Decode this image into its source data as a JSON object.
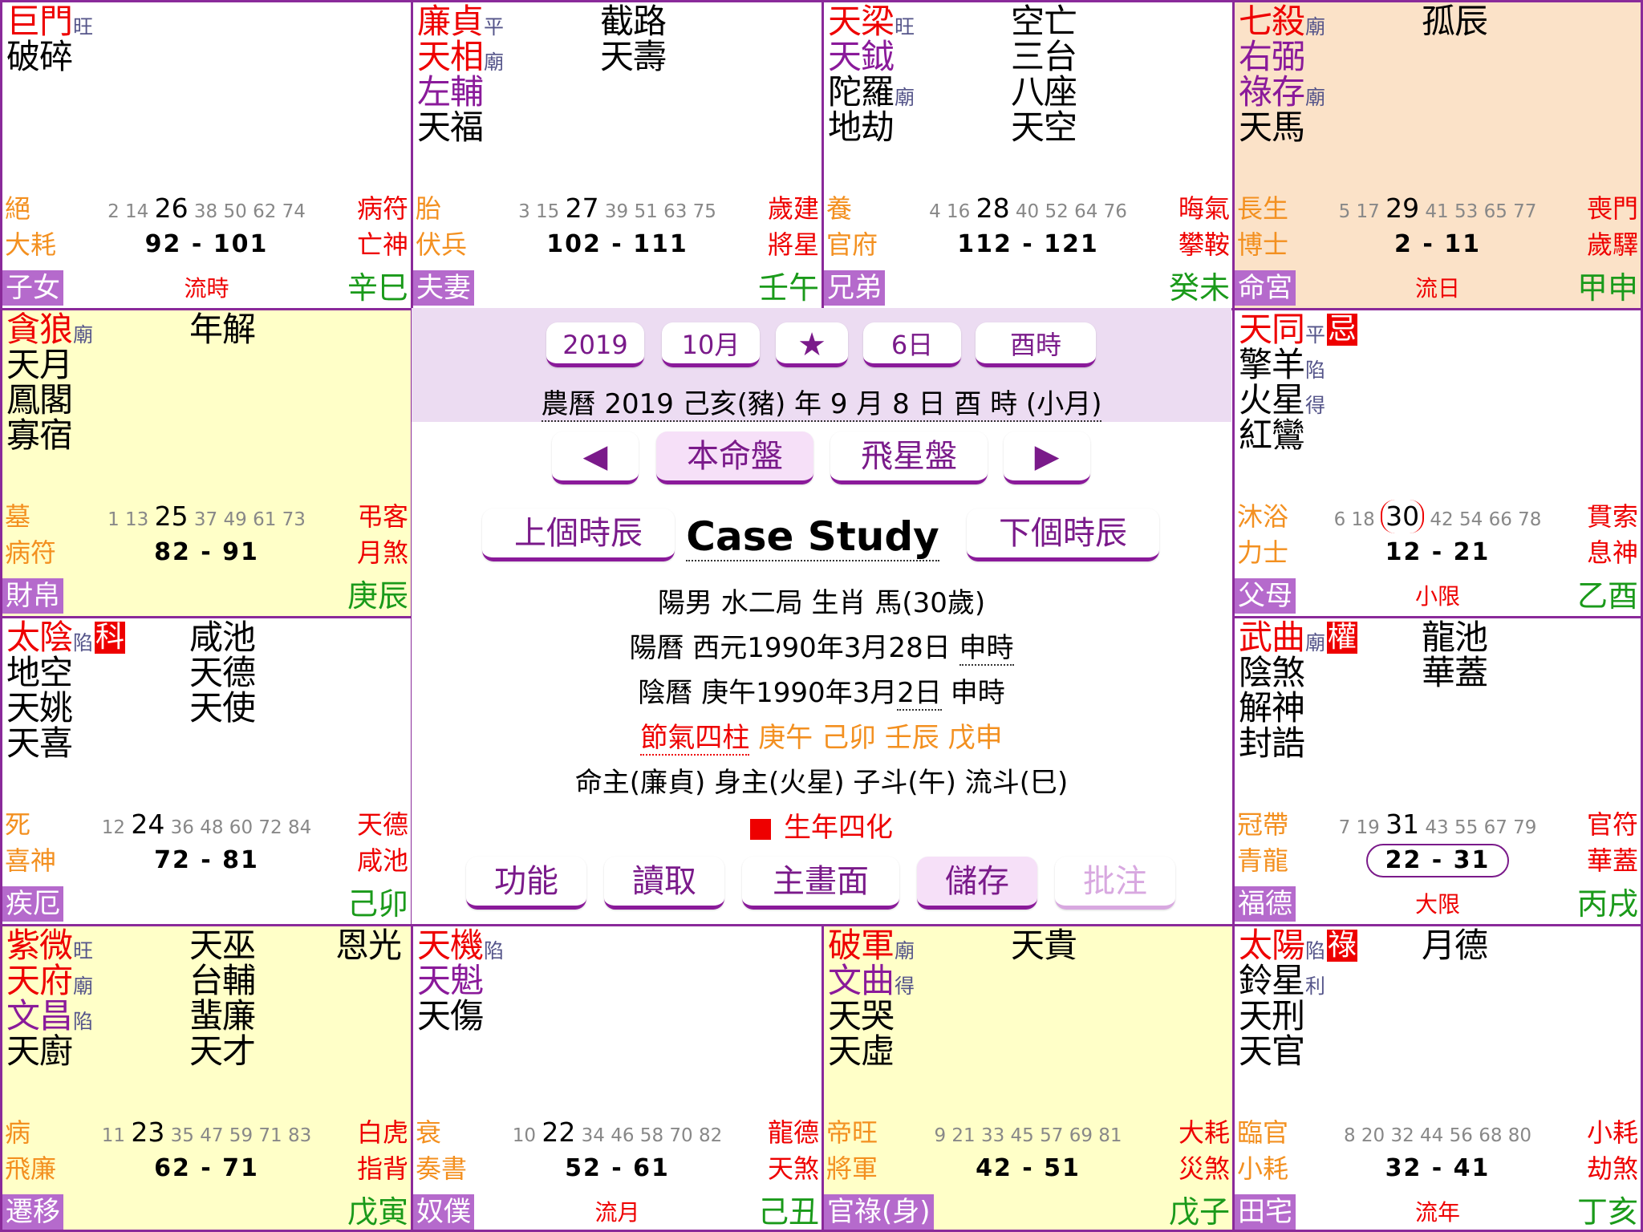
{
  "palaces": [
    {
      "id": "si",
      "stars": [
        {
          "n": "巨門",
          "c": "red",
          "b": "旺"
        },
        {
          "n": "破碎",
          "c": "black"
        }
      ],
      "minor1": [],
      "minor2": [],
      "state": "絕",
      "god": "大耗",
      "ages": {
        "pre": "2 14",
        "big": "26",
        "post": "38 50 62 74"
      },
      "range": "92 - 101",
      "r1": "病符",
      "r2": "亡神",
      "name": "子女",
      "liu": "流時",
      "stem": "辛巳"
    },
    {
      "id": "wu",
      "stars": [
        {
          "n": "廉貞",
          "c": "red",
          "b": "平"
        },
        {
          "n": "天相",
          "c": "red",
          "b": "廟"
        },
        {
          "n": "左輔",
          "c": "purple"
        },
        {
          "n": "天福",
          "c": "black"
        }
      ],
      "minor1": [
        "截路",
        "天壽"
      ],
      "minor2": [],
      "state": "胎",
      "god": "伏兵",
      "ages": {
        "pre": "3 15",
        "big": "27",
        "post": "39 51 63 75"
      },
      "range": "102 - 111",
      "r1": "歲建",
      "r2": "將星",
      "name": "夫妻",
      "liu": "",
      "stem": "壬午"
    },
    {
      "id": "wei",
      "stars": [
        {
          "n": "天梁",
          "c": "red",
          "b": "旺"
        },
        {
          "n": "天鉞",
          "c": "purple"
        },
        {
          "n": "陀羅",
          "c": "black",
          "b": "廟"
        },
        {
          "n": "地劫",
          "c": "black"
        }
      ],
      "minor1": [
        "空亡",
        "三台",
        "八座",
        "天空"
      ],
      "minor2": [],
      "state": "養",
      "god": "官府",
      "ages": {
        "pre": "4 16",
        "big": "28",
        "post": "40 52 64 76"
      },
      "range": "112 - 121",
      "r1": "晦氣",
      "r2": "攀鞍",
      "name": "兄弟",
      "liu": "",
      "stem": "癸未"
    },
    {
      "id": "shen",
      "stars": [
        {
          "n": "七殺",
          "c": "red",
          "b": "廟"
        },
        {
          "n": "右弼",
          "c": "purple"
        },
        {
          "n": "祿存",
          "c": "purple",
          "b": "廟"
        },
        {
          "n": "天馬",
          "c": "black"
        }
      ],
      "minor1": [
        "孤辰"
      ],
      "minor2": [],
      "state": "長生",
      "god": "博士",
      "ages": {
        "pre": "5 17",
        "big": "29",
        "post": "41 53 65 77"
      },
      "range": "2 - 11",
      "r1": "喪門",
      "r2": "歲驛",
      "name": "命宮",
      "liu": "流日",
      "stem": "甲申"
    },
    {
      "id": "chen",
      "stars": [
        {
          "n": "貪狼",
          "c": "red",
          "b": "廟"
        },
        {
          "n": "天月",
          "c": "black"
        },
        {
          "n": "鳳閣",
          "c": "black"
        },
        {
          "n": "寡宿",
          "c": "black"
        }
      ],
      "minor1": [
        "年解"
      ],
      "minor2": [],
      "state": "墓",
      "god": "病符",
      "ages": {
        "pre": "1 13",
        "big": "25",
        "post": "37 49 61 73"
      },
      "range": "82 - 91",
      "r1": "弔客",
      "r2": "月煞",
      "name": "財帛",
      "liu": "",
      "stem": "庚辰"
    },
    {
      "id": "you",
      "stars": [
        {
          "n": "天同",
          "c": "red",
          "b": "平",
          "h": "忌"
        },
        {
          "n": "擎羊",
          "c": "black",
          "b": "陷"
        },
        {
          "n": "火星",
          "c": "black",
          "b": "得"
        },
        {
          "n": "紅鸞",
          "c": "black"
        }
      ],
      "minor1": [],
      "minor2": [],
      "state": "沐浴",
      "god": "力士",
      "ages": {
        "pre": "6 18",
        "big": "30",
        "post": "42 54 66 78",
        "circle": true
      },
      "range": "12 - 21",
      "r1": "貫索",
      "r2": "息神",
      "name": "父母",
      "liu": "小限",
      "stem": "乙酉"
    },
    {
      "id": "mao",
      "stars": [
        {
          "n": "太陰",
          "c": "red",
          "b": "陷",
          "h": "科"
        },
        {
          "n": "地空",
          "c": "black"
        },
        {
          "n": "天姚",
          "c": "black"
        },
        {
          "n": "天喜",
          "c": "black"
        }
      ],
      "minor1": [
        "咸池",
        "天德",
        "天使"
      ],
      "minor2": [],
      "state": "死",
      "god": "喜神",
      "ages": {
        "pre": "12",
        "big": "24",
        "post": "36 48 60 72 84"
      },
      "range": "72 - 81",
      "r1": "天德",
      "r2": "咸池",
      "name": "疾厄",
      "liu": "",
      "stem": "己卯"
    },
    {
      "id": "xu",
      "stars": [
        {
          "n": "武曲",
          "c": "red",
          "b": "廟",
          "h": "權"
        },
        {
          "n": "陰煞",
          "c": "black"
        },
        {
          "n": "解神",
          "c": "black"
        },
        {
          "n": "封誥",
          "c": "black"
        }
      ],
      "minor1": [
        "龍池",
        "華蓋"
      ],
      "minor2": [],
      "state": "冠帶",
      "god": "青龍",
      "ages": {
        "pre": "7 19",
        "big": "31",
        "post": "43 55 67 79"
      },
      "range": "22 - 31",
      "oval": true,
      "r1": "官符",
      "r2": "華蓋",
      "name": "福德",
      "liu": "大限",
      "stem": "丙戌"
    },
    {
      "id": "yin",
      "stars": [
        {
          "n": "紫微",
          "c": "red",
          "b": "旺"
        },
        {
          "n": "天府",
          "c": "red",
          "b": "廟"
        },
        {
          "n": "文昌",
          "c": "purple",
          "b": "陷"
        },
        {
          "n": "天廚",
          "c": "black"
        }
      ],
      "minor1": [
        "天巫",
        "台輔",
        "蜚廉",
        "天才"
      ],
      "minor2": [
        "恩光"
      ],
      "state": "病",
      "god": "飛廉",
      "ages": {
        "pre": "11",
        "big": "23",
        "post": "35 47 59 71 83"
      },
      "range": "62 - 71",
      "r1": "白虎",
      "r2": "指背",
      "name": "遷移",
      "liu": "",
      "stem": "戊寅"
    },
    {
      "id": "chou",
      "stars": [
        {
          "n": "天機",
          "c": "red",
          "b": "陷"
        },
        {
          "n": "天魁",
          "c": "purple"
        },
        {
          "n": "天傷",
          "c": "black"
        }
      ],
      "minor1": [],
      "minor2": [],
      "state": "衰",
      "god": "奏書",
      "ages": {
        "pre": "10",
        "big": "22",
        "post": "34 46 58 70 82"
      },
      "range": "52 - 61",
      "r1": "龍德",
      "r2": "天煞",
      "name": "奴僕",
      "liu": "流月",
      "stem": "己丑"
    },
    {
      "id": "zi",
      "stars": [
        {
          "n": "破軍",
          "c": "red",
          "b": "廟"
        },
        {
          "n": "文曲",
          "c": "purple",
          "b": "得"
        },
        {
          "n": "天哭",
          "c": "black"
        },
        {
          "n": "天虛",
          "c": "black"
        }
      ],
      "minor1": [
        "天貴"
      ],
      "minor2": [],
      "state": "帝旺",
      "god": "將軍",
      "ages": {
        "pre": "9 21",
        "big": "",
        "post": "33 45 57 69 81"
      },
      "range": "42 - 51",
      "r1": "大耗",
      "r2": "災煞",
      "name": "官祿(身)",
      "liu": "",
      "stem": "戊子"
    },
    {
      "id": "hai",
      "stars": [
        {
          "n": "太陽",
          "c": "red",
          "b": "陷",
          "h": "祿"
        },
        {
          "n": "鈴星",
          "c": "black",
          "b": "利"
        },
        {
          "n": "天刑",
          "c": "black"
        },
        {
          "n": "天官",
          "c": "black"
        }
      ],
      "minor1": [
        "月德"
      ],
      "minor2": [],
      "state": "臨官",
      "god": "小耗",
      "ages": {
        "pre": "8 20",
        "big": "",
        "post": "32 44 56 68 80"
      },
      "range": "32 - 41",
      "r1": "小耗",
      "r2": "劫煞",
      "name": "田宅",
      "liu": "流年",
      "stem": "丁亥"
    }
  ],
  "controls": {
    "year": "2019",
    "month": "10月",
    "star": "★",
    "day": "6日",
    "hour": "酉時",
    "lunar": "農曆 2019 己亥(豬) 年 9 月 8 日 酉 時 (小月)",
    "prev": "◀",
    "natal": "本命盤",
    "flying": "飛星盤",
    "next": "▶",
    "prev_hour": "上個時辰",
    "next_hour": "下個時辰",
    "title": "Case Study"
  },
  "info": {
    "line1": "陽男 水二局 生肖 馬(30歲)",
    "line2a": "陽曆 西元1990年3月28日 ",
    "line2b": "申時",
    "line3a": "陰曆 庚午1990年3月",
    "line3b": "2日",
    "line3c": " 申時",
    "line4a": "節氣四柱",
    "line4b": " 庚午  己卯  壬辰  戊申",
    "line5": "命主(廉貞)  身主(火星) 子斗(午)  流斗(巳)",
    "line6": "生年四化"
  },
  "buttons": {
    "func": "功能",
    "read": "讀取",
    "main": "主畫面",
    "save": "儲存",
    "note": "批注"
  },
  "colors": {
    "border": "#8a2a9a",
    "red": "#ee0000",
    "purple": "#8a1a9a",
    "orange": "#f39020",
    "green": "#1a9a1a",
    "yellow": "#ffffc8",
    "peach": "#fbe2c8",
    "center_top": "#ecdcf2"
  }
}
